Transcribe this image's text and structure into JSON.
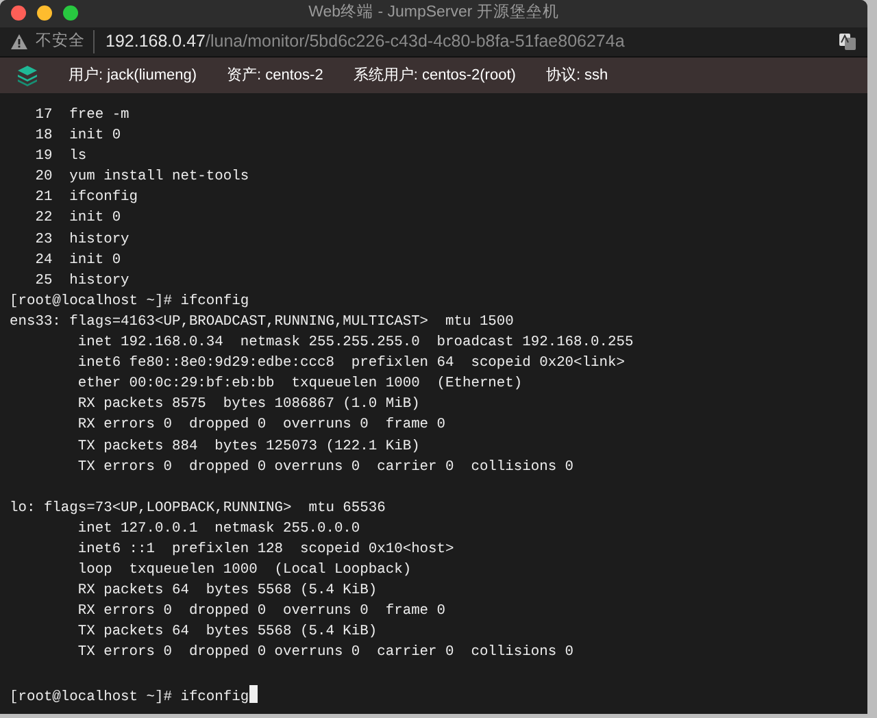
{
  "window": {
    "title": "Web终端 - JumpServer 开源堡垒机"
  },
  "address_bar": {
    "security": "不安全",
    "host": "192.168.0.47",
    "path": "/luna/monitor/5bd6c226-c43d-4c80-b8fa-51fae806274a"
  },
  "session_bar": [
    {
      "label": "用户:",
      "value": "jack(liumeng)"
    },
    {
      "label": "资产:",
      "value": "centos-2"
    },
    {
      "label": "系统用户:",
      "value": "centos-2(root)"
    },
    {
      "label": "协议:",
      "value": "ssh"
    }
  ],
  "terminal": {
    "blocks": [
      [
        "   17  free -m",
        "   18  init 0",
        "   19  ls",
        "   20  yum install net-tools",
        "   21  ifconfig",
        "   22  init 0",
        "   23  history",
        "   24  init 0",
        "   25  history",
        "[root@localhost ~]# ifconfig",
        "ens33: flags=4163<UP,BROADCAST,RUNNING,MULTICAST>  mtu 1500",
        "        inet 192.168.0.34  netmask 255.255.255.0  broadcast 192.168.0.255",
        "        inet6 fe80::8e0:9d29:edbe:ccc8  prefixlen 64  scopeid 0x20<link>",
        "        ether 00:0c:29:bf:eb:bb  txqueuelen 1000  (Ethernet)",
        "        RX packets 8575  bytes 1086867 (1.0 MiB)",
        "        RX errors 0  dropped 0  overruns 0  frame 0",
        "        TX packets 884  bytes 125073 (122.1 KiB)",
        "        TX errors 0  dropped 0 overruns 0  carrier 0  collisions 0"
      ],
      [
        "lo: flags=73<UP,LOOPBACK,RUNNING>  mtu 65536",
        "        inet 127.0.0.1  netmask 255.0.0.0",
        "        inet6 ::1  prefixlen 128  scopeid 0x10<host>",
        "        loop  txqueuelen 1000  (Local Loopback)",
        "        RX packets 64  bytes 5568 (5.4 KiB)",
        "        RX errors 0  dropped 0  overruns 0  frame 0",
        "        TX packets 64  bytes 5568 (5.4 KiB)",
        "        TX errors 0  dropped 0 overruns 0  carrier 0  collisions 0"
      ]
    ],
    "input_line": {
      "text": "[root@localhost ~]# ifconfig",
      "cursor": true
    }
  }
}
